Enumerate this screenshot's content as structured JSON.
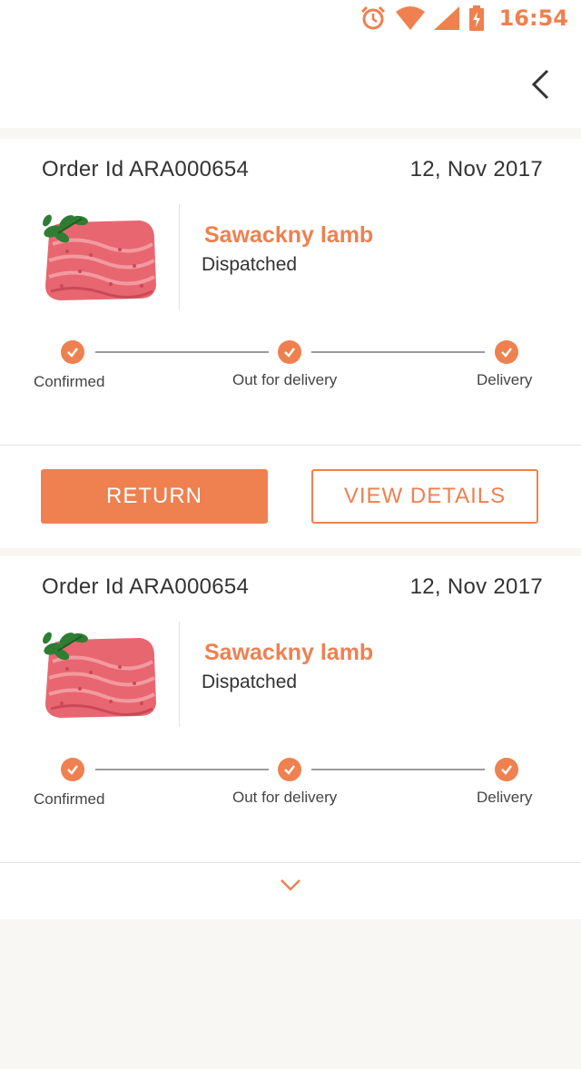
{
  "status_bar": {
    "time": "16:54",
    "icons": [
      "alarm-icon",
      "wifi-icon",
      "signal-icon",
      "battery-charging-icon"
    ],
    "accent": "#ef8050"
  },
  "header": {
    "back_icon": "chevron-left-icon"
  },
  "colors": {
    "accent": "#ef8050",
    "text": "#333333",
    "background": "#f8f7f4"
  },
  "orders": [
    {
      "order_id": "Order Id ARA000654",
      "date": "12, Nov 2017",
      "product_name": "Sawackny lamb",
      "status": "Dispatched",
      "steps": [
        "Confirmed",
        "Out for delivery",
        "Delivery"
      ],
      "actions": {
        "return_label": "RETURN",
        "details_label": "VIEW DETAILS"
      }
    },
    {
      "order_id": "Order Id ARA000654",
      "date": "12, Nov 2017",
      "product_name": "Sawackny lamb",
      "status": "Dispatched",
      "steps": [
        "Confirmed",
        "Out for delivery",
        "Delivery"
      ],
      "expand_icon": "chevron-down-icon"
    }
  ]
}
